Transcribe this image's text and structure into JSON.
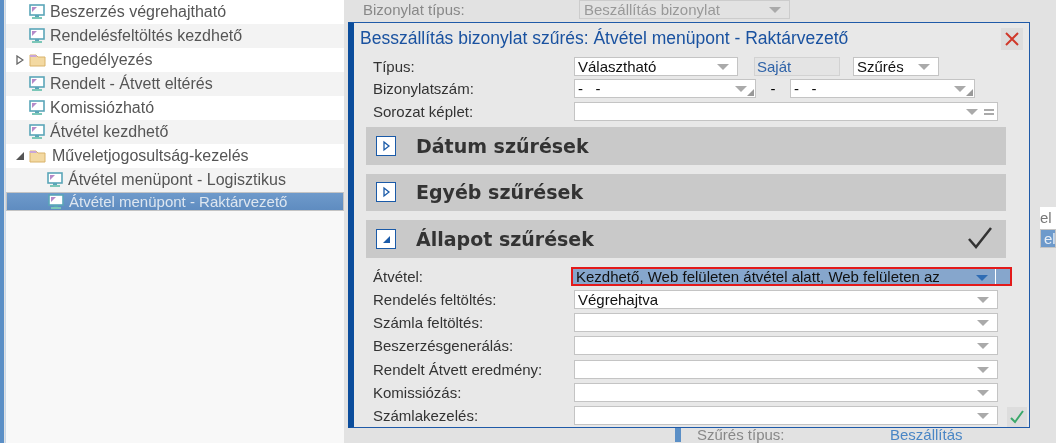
{
  "tree": {
    "items": [
      {
        "label": "Beszerzés végrehajtható",
        "kind": "screen",
        "selected": false
      },
      {
        "label": "Rendelésfeltöltés kezdhető",
        "kind": "screen",
        "selected": false
      },
      {
        "label": "Engedélyezés",
        "kind": "folder",
        "expanded": false,
        "selected": false
      },
      {
        "label": "Rendelt - Átvett eltérés",
        "kind": "screen",
        "selected": false
      },
      {
        "label": "Komissiózható",
        "kind": "screen",
        "selected": false
      },
      {
        "label": "Átvétel kezdhető",
        "kind": "screen",
        "selected": false
      },
      {
        "label": "Műveletjogosultság-kezelés",
        "kind": "folder",
        "expanded": true,
        "selected": false,
        "children": [
          {
            "label": "Átvétel menüpont - Logisztikus",
            "kind": "screen",
            "selected": false
          },
          {
            "label": "Átvétel menüpont - Raktárvezető",
            "kind": "screen",
            "selected": true
          }
        ]
      }
    ]
  },
  "background": {
    "top_field": {
      "label": "Bizonylat típus:",
      "value": "Beszállítás bizonylat",
      "disabled": true
    },
    "side_list": [
      {
        "text": "el",
        "selected": false
      },
      {
        "text": "el",
        "selected": true
      }
    ],
    "bottom_field": {
      "label": "Szűrés típus:",
      "value": "Beszállítás"
    }
  },
  "dialog": {
    "title": "Besszállítás bizonylat szűrés: Átvétel menüpont - Raktárvezető",
    "type_row": {
      "label": "Típus:",
      "mode": "Választható",
      "own": "Saját",
      "filter": "Szűrés"
    },
    "number_row": {
      "label": "Bizonylatszám:",
      "from": "-   -",
      "separator": "-",
      "to": "-   -"
    },
    "series_row": {
      "label": "Sorozat képlet:"
    },
    "sections": [
      {
        "title": "Dátum szűrések",
        "expanded": false,
        "applied": false
      },
      {
        "title": "Egyéb szűrések",
        "expanded": false,
        "applied": false
      },
      {
        "title": "Állapot szűrések",
        "expanded": true,
        "applied": true
      }
    ],
    "status_fields": [
      {
        "label": "Átvétel:",
        "value": "Kezdhető, Web felületen átvétel alatt, Web felületen az",
        "focused": true
      },
      {
        "label": "Rendelés feltöltés:",
        "value": "Végrehajtva",
        "focused": false
      },
      {
        "label": "Számla feltöltés:",
        "focused": false
      },
      {
        "label": "Beszerzésgenerálás:",
        "focused": false
      },
      {
        "label": "Rendelt Átvett eredmény:",
        "focused": false
      },
      {
        "label": "Komissiózás:",
        "focused": false
      },
      {
        "label": "Számlakezelés:",
        "focused": false
      }
    ]
  }
}
